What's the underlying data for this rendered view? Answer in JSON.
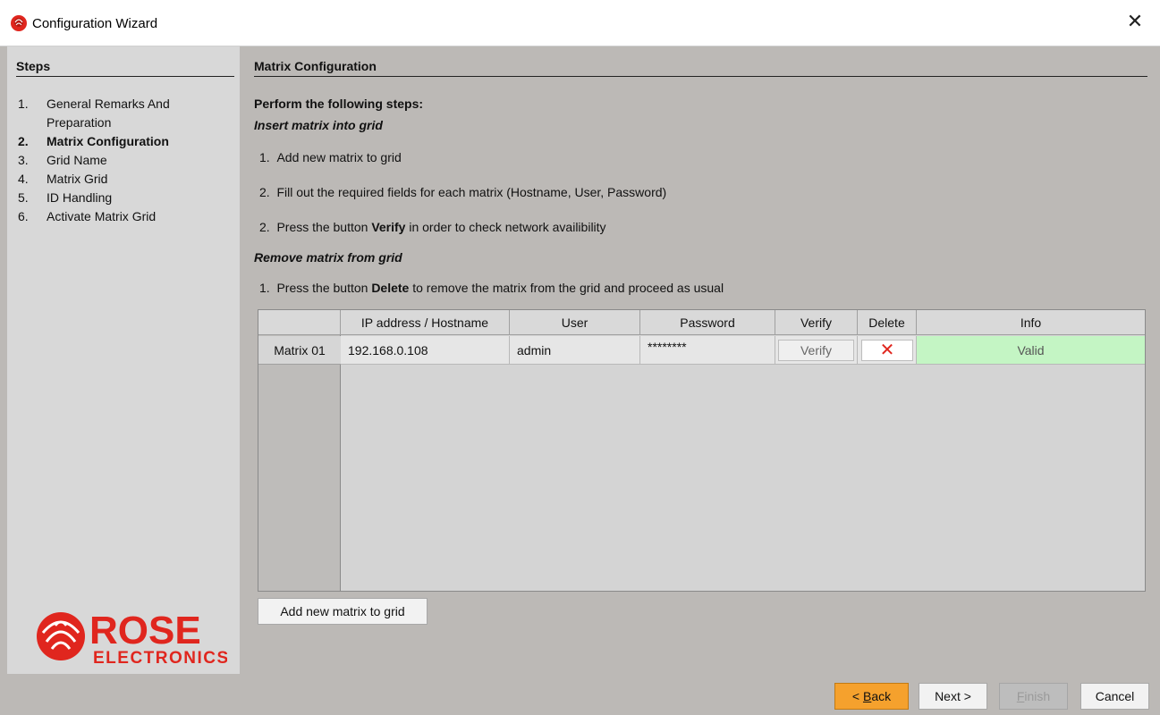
{
  "window": {
    "title": "Configuration Wizard",
    "icon": "rose-icon",
    "close_glyph": "✕"
  },
  "steps": {
    "header": "Steps",
    "items": [
      {
        "num": "1.",
        "label": "General Remarks And Preparation",
        "active": false
      },
      {
        "num": "2.",
        "label": "Matrix Configuration",
        "active": true
      },
      {
        "num": "3.",
        "label": "Grid Name",
        "active": false
      },
      {
        "num": "4.",
        "label": "Matrix Grid",
        "active": false
      },
      {
        "num": "5.",
        "label": "ID Handling",
        "active": false
      },
      {
        "num": "6.",
        "label": "Activate Matrix Grid",
        "active": false
      }
    ],
    "logo": {
      "word1": "ROSE",
      "word2": "ELECTRONICS",
      "color": "#e0261e"
    }
  },
  "main": {
    "title": "Matrix Configuration",
    "intro": "Perform the following steps:",
    "insert_heading": "Insert matrix into grid",
    "insert_steps": [
      {
        "num": "1.",
        "pre": "Add new matrix to grid",
        "bold": "",
        "post": ""
      },
      {
        "num": "2.",
        "pre": "Fill out the required fields for each matrix (Hostname, User, Password)",
        "bold": "",
        "post": ""
      },
      {
        "num": "2.",
        "pre": "Press the button ",
        "bold": "Verify",
        "post": " in order to check network availibility"
      }
    ],
    "remove_heading": "Remove matrix from grid",
    "remove_steps": [
      {
        "num": "1.",
        "pre": "Press the button ",
        "bold": "Delete",
        "post": " to remove the matrix from the grid and proceed as usual"
      }
    ]
  },
  "table": {
    "columns": [
      "IP address / Hostname",
      "User",
      "Password",
      "Verify",
      "Delete",
      "Info"
    ],
    "rows": [
      {
        "label": "Matrix 01",
        "host": "192.168.0.108",
        "user": "admin",
        "password": "********",
        "verify": "Verify",
        "delete_glyph": "✕",
        "info": "Valid"
      }
    ],
    "valid_color": "#c4f5c4"
  },
  "buttons": {
    "add_matrix": "Add new matrix to grid",
    "back_prefix": "< ",
    "back_mnemonic": "B",
    "back_rest": "ack",
    "next": "Next >",
    "finish_mnemonic": "F",
    "finish_rest": "inish",
    "cancel": "Cancel",
    "accent": "#f5a12d"
  }
}
